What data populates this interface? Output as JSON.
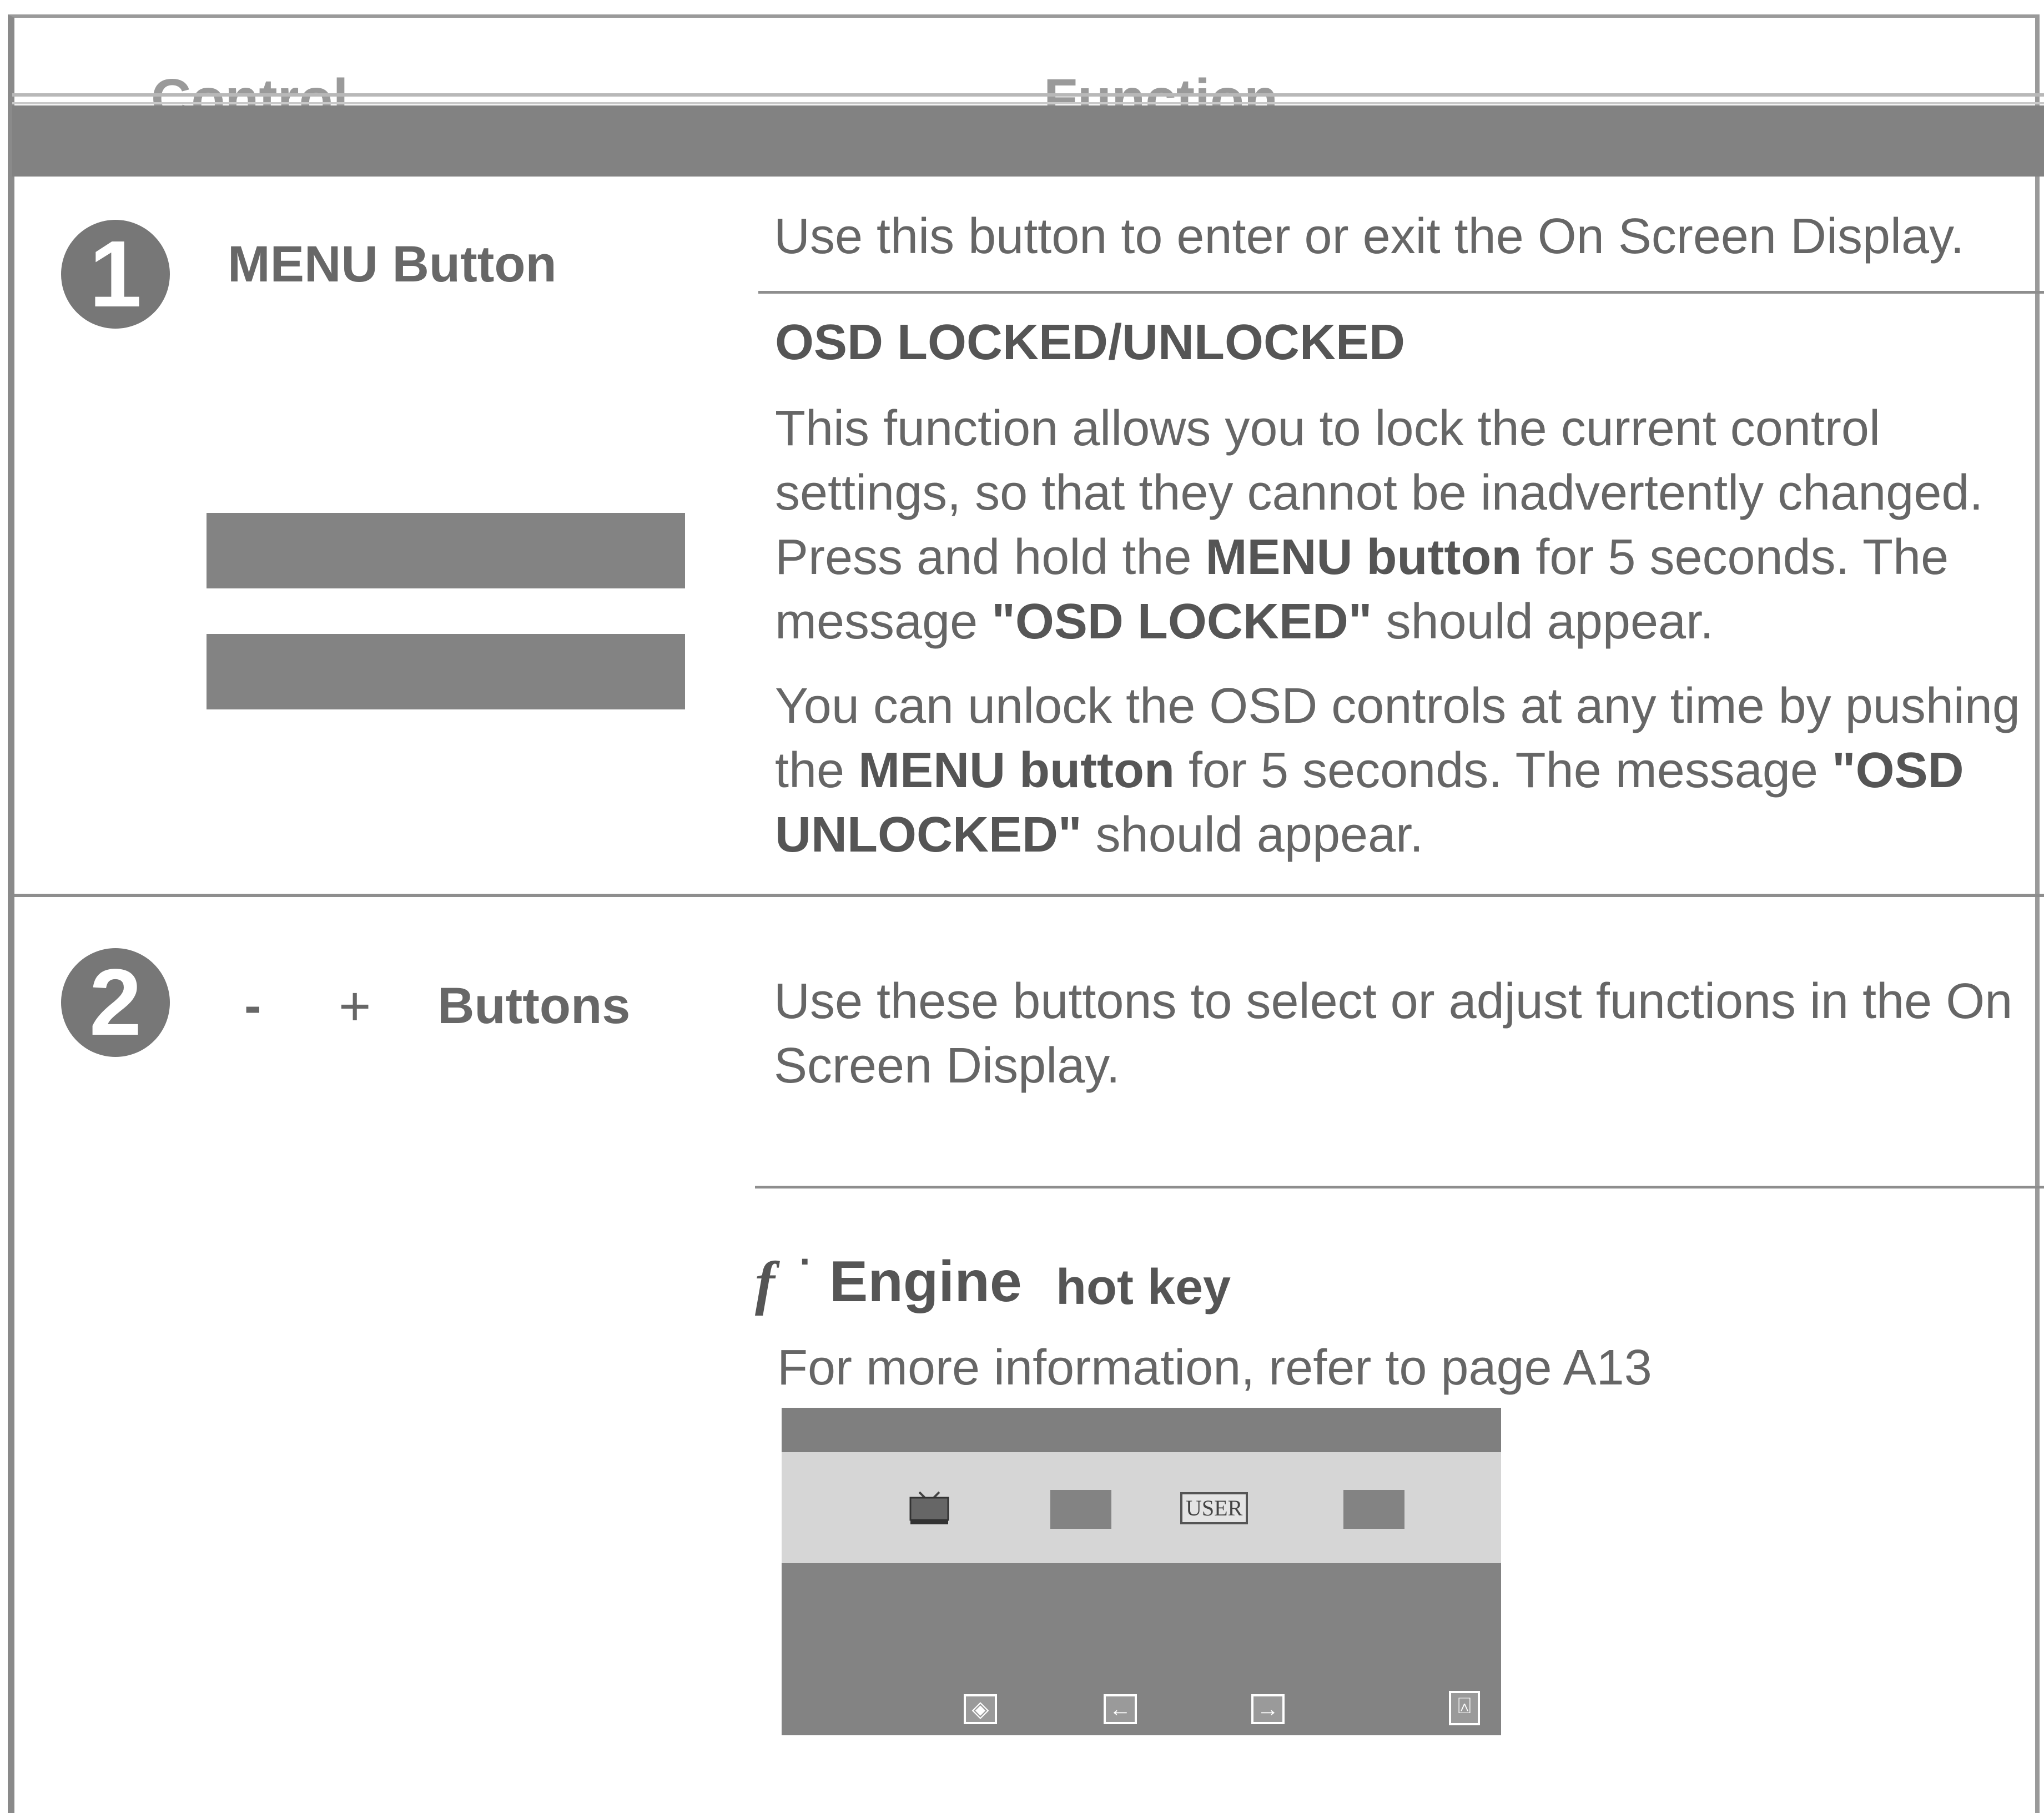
{
  "header": {
    "control": "Control",
    "function": "Function"
  },
  "rows": [
    {
      "number": "1",
      "control_label": "MENU Button",
      "intro": "Use this button to enter or exit the On Screen Display.",
      "subheading": "OSD LOCKED/UNLOCKED",
      "p1": {
        "a": "This function allows you to lock the current control settings, so that they cannot be inadvertently changed. Press and hold the ",
        "b": "MENU button",
        "c": " for 5 seconds. The message ",
        "d": "\"OSD LOCKED\"",
        "e": " should appear."
      },
      "p2": {
        "a": "You can unlock the OSD controls at any time by pushing the ",
        "b": "MENU button",
        "c": " for 5 seconds. The message ",
        "d": "\"OSD UNLOCKED\"",
        "e": " should appear."
      }
    },
    {
      "number": "2",
      "control_minus": "-",
      "control_plus": "+",
      "control_label": "Buttons",
      "intro": "Use these buttons to select or adjust functions in the On Screen Display.",
      "hotkey_brand_f": "f",
      "hotkey_brand": "Engine",
      "hotkey_label": "hot key",
      "hotkey_info": "For more information, refer to page A13",
      "osd_user_label": "USER"
    }
  ],
  "icons": [
    "tv-icon",
    "user-mode-icon",
    "select-icon",
    "left-arrow-icon",
    "right-arrow-icon",
    "exit-icon"
  ],
  "colors": {
    "bar_gray": "#838383",
    "text_gray": "#666666"
  }
}
